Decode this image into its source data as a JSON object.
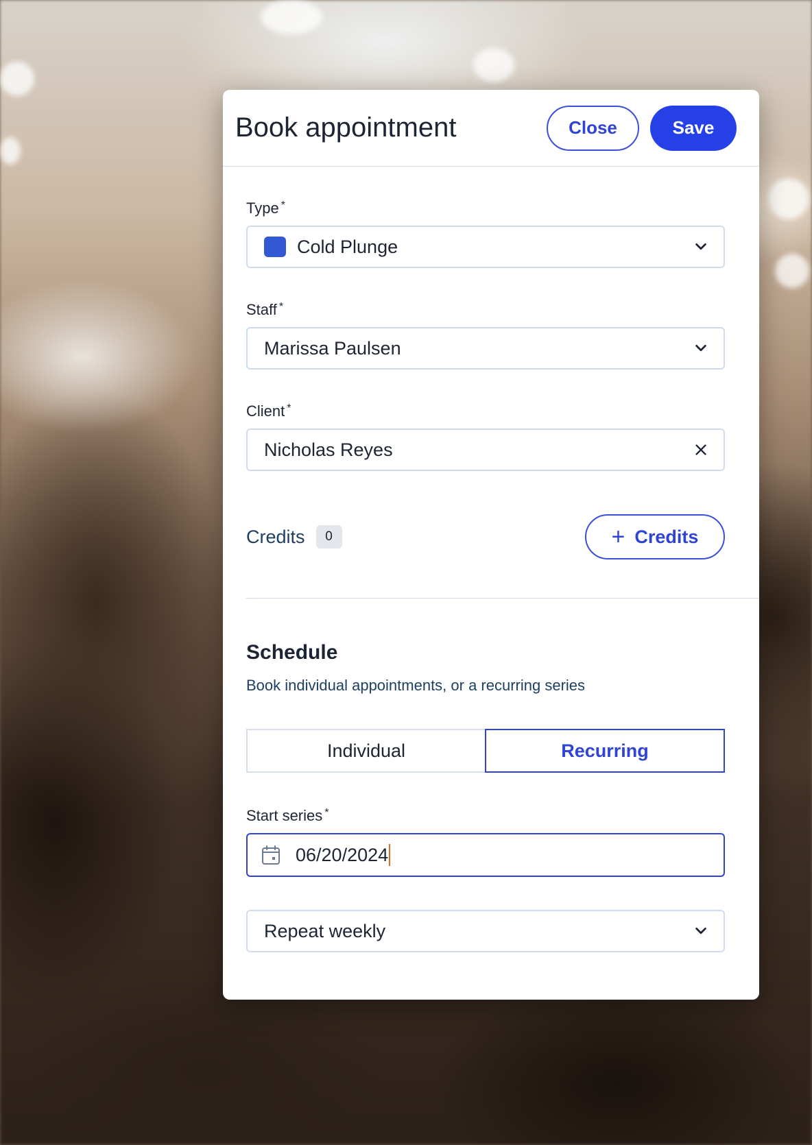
{
  "dialog": {
    "title": "Book appointment",
    "close_label": "Close",
    "save_label": "Save"
  },
  "type_field": {
    "label": "Type",
    "required_mark": "*",
    "value": "Cold Plunge",
    "swatch_color": "#3358d4"
  },
  "staff_field": {
    "label": "Staff",
    "required_mark": "*",
    "value": "Marissa Paulsen"
  },
  "client_field": {
    "label": "Client",
    "required_mark": "*",
    "value": "Nicholas Reyes"
  },
  "credits": {
    "label": "Credits",
    "count": "0",
    "add_button_label": "Credits",
    "add_button_icon": "+"
  },
  "schedule": {
    "title": "Schedule",
    "subtitle": "Book individual appointments, or a recurring series",
    "options": [
      "Individual",
      "Recurring"
    ],
    "selected": "Recurring"
  },
  "start_series": {
    "label": "Start series",
    "required_mark": "*",
    "value": "06/20/2024"
  },
  "repeat": {
    "value": "Repeat weekly"
  },
  "colors": {
    "accent": "#2440e6",
    "accent_text": "#2f44d4",
    "text": "#1d2433",
    "subtext": "#1e3f63"
  }
}
